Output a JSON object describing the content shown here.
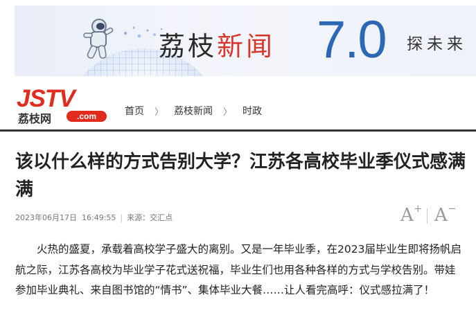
{
  "banner": {
    "title_black": "荔枝",
    "title_red": "新闻",
    "version": "7.0",
    "slogan": "探未来"
  },
  "logo": {
    "jstv": "JSTV",
    "cn": "荔枝网",
    "com": ".com"
  },
  "breadcrumb": {
    "items": [
      "首页",
      "荔枝新闻",
      "时政"
    ],
    "separator": "〉"
  },
  "article": {
    "headline": "该以什么样的方式告别大学？江苏各高校毕业季仪式感满满",
    "date": "2023年06月17日",
    "time": "16:49:55",
    "source": "来源：交汇点",
    "paragraph": "火热的盛夏，承载着高校学子盛大的离别。又是一年毕业季，在2023届毕业生即将扬帆启航之际，江苏各高校为毕业学子花式送祝福，毕业生们也用各种各样的方式与学校告别。带娃参加毕业典礼、来自图书馆的“情书”、集体毕业大餐……让人看完高呼：仪式感拉满了！"
  },
  "font_controls": {
    "increase_base": "A",
    "increase_mod": "+",
    "decrease_base": "A",
    "decrease_mod": "−"
  },
  "colors": {
    "brand_red": "#e02b1d",
    "banner_blue": "#2c67b5"
  }
}
